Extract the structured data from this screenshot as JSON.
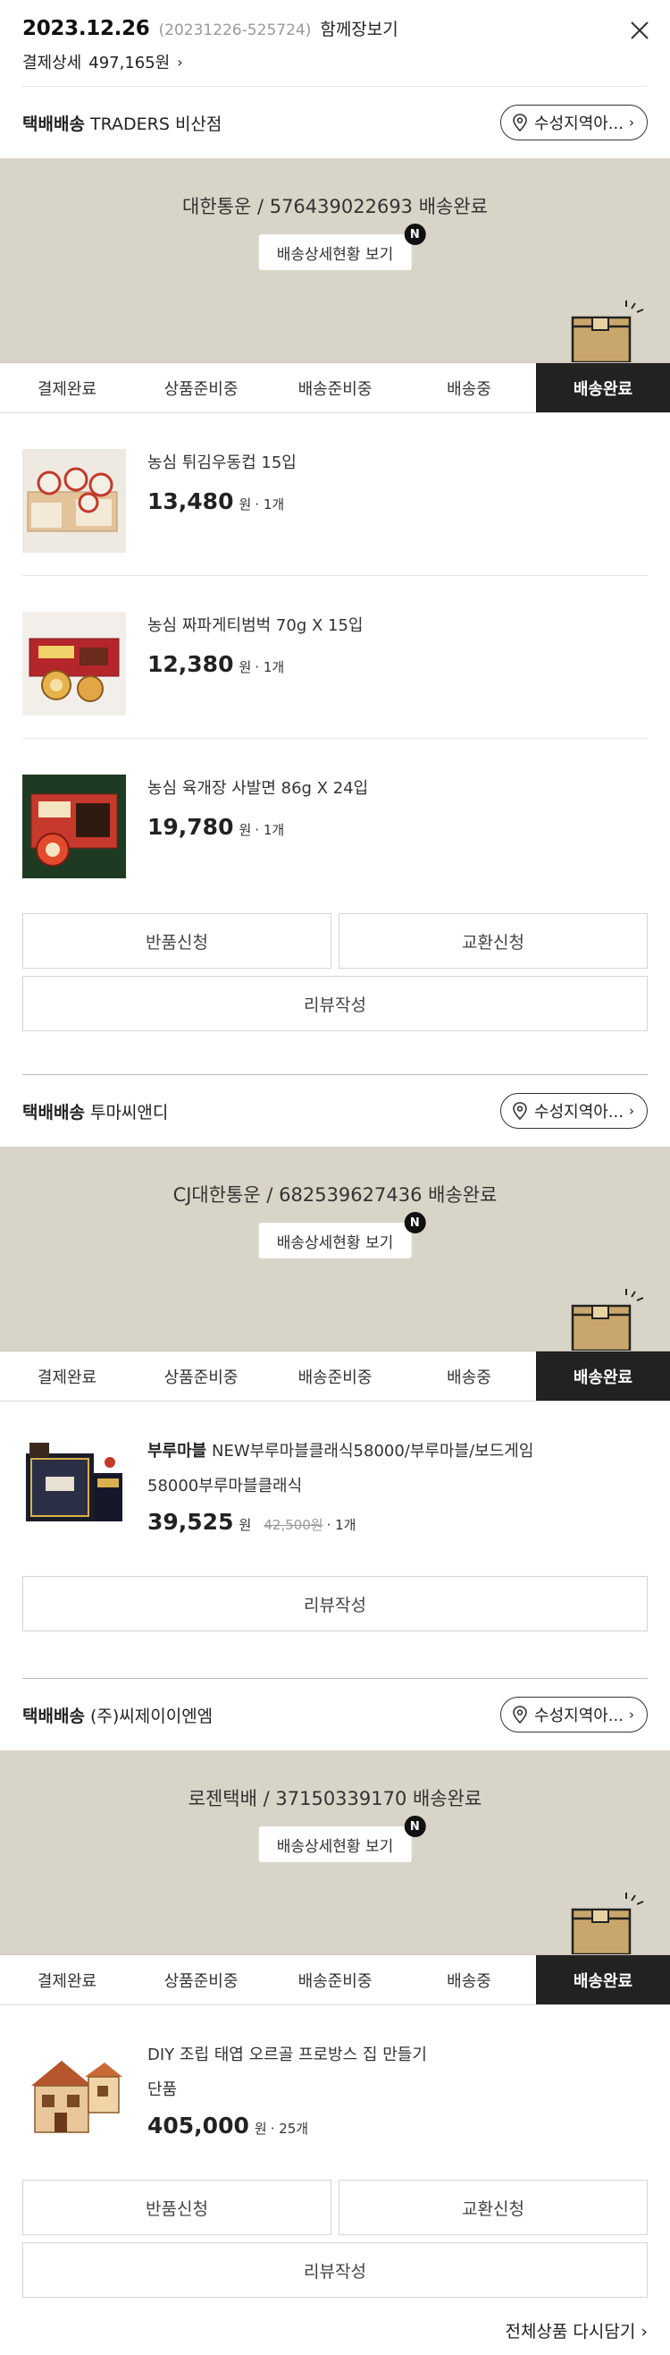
{
  "order": {
    "date": "2023.12.26",
    "number": "(20231226-525724)",
    "bundle_link": "함께장보기",
    "payment_label": "결제상세",
    "payment_amount": "497,165원",
    "chevron": "›"
  },
  "steps": [
    "결제완료",
    "상품준비중",
    "배송준비중",
    "배송중",
    "배송완료"
  ],
  "active_step": 4,
  "area_button_label": "수성지역아...",
  "detail_button_label": "배송상세현황 보기",
  "badge_new": "N",
  "shipments": [
    {
      "type": "택배배송",
      "seller": "TRADERS 비산점",
      "carrier_status": "대한통운 / 576439022693 배송완료",
      "items": [
        {
          "name": "농심 튀김우동컵 15입",
          "price": "13,480",
          "unit": "원",
          "qty": "· 1개",
          "icon": "ramen-cup-box-image"
        },
        {
          "name": "농심 짜파게티범벅 70g X 15입",
          "price": "12,380",
          "unit": "원",
          "qty": "· 1개",
          "icon": "jjapaghetti-box-image"
        },
        {
          "name": "농심 육개장 사발면 86g X 24입",
          "price": "19,780",
          "unit": "원",
          "qty": "· 1개",
          "icon": "yukgaejang-box-image"
        }
      ],
      "buttons": {
        "return": "반품신청",
        "exchange": "교환신청",
        "review": "리뷰작성"
      }
    },
    {
      "type": "택배배송",
      "seller": "투마씨앤디",
      "carrier_status": "CJ대한통운 / 682539627436 배송완료",
      "items": [
        {
          "brand": "부루마블",
          "name": "NEW부루마블클래식58000/부루마블/보드게임",
          "option": "58000부루마블클래식",
          "price": "39,525",
          "unit": "원",
          "original": "42,500원",
          "qty": "· 1개",
          "icon": "board-game-image"
        }
      ],
      "buttons": {
        "review": "리뷰작성"
      }
    },
    {
      "type": "택배배송",
      "seller": "(주)씨제이이엔엠",
      "carrier_status": "로젠택배 / 37150339170 배송완료",
      "items": [
        {
          "name": "DIY 조립 태엽 오르골 프로방스 집 만들기",
          "option": "단품",
          "price": "405,000",
          "unit": "원",
          "qty": "· 25개",
          "icon": "music-box-house-image"
        }
      ],
      "buttons": {
        "return": "반품신청",
        "exchange": "교환신청",
        "review": "리뷰작성"
      }
    }
  ],
  "footer": {
    "reorder_all": "전체상품 다시담기 ›"
  },
  "colors": {
    "banner_bg": "#d8d5c8",
    "active_step_bg": "#222222",
    "box_color": "#c9a66b"
  }
}
